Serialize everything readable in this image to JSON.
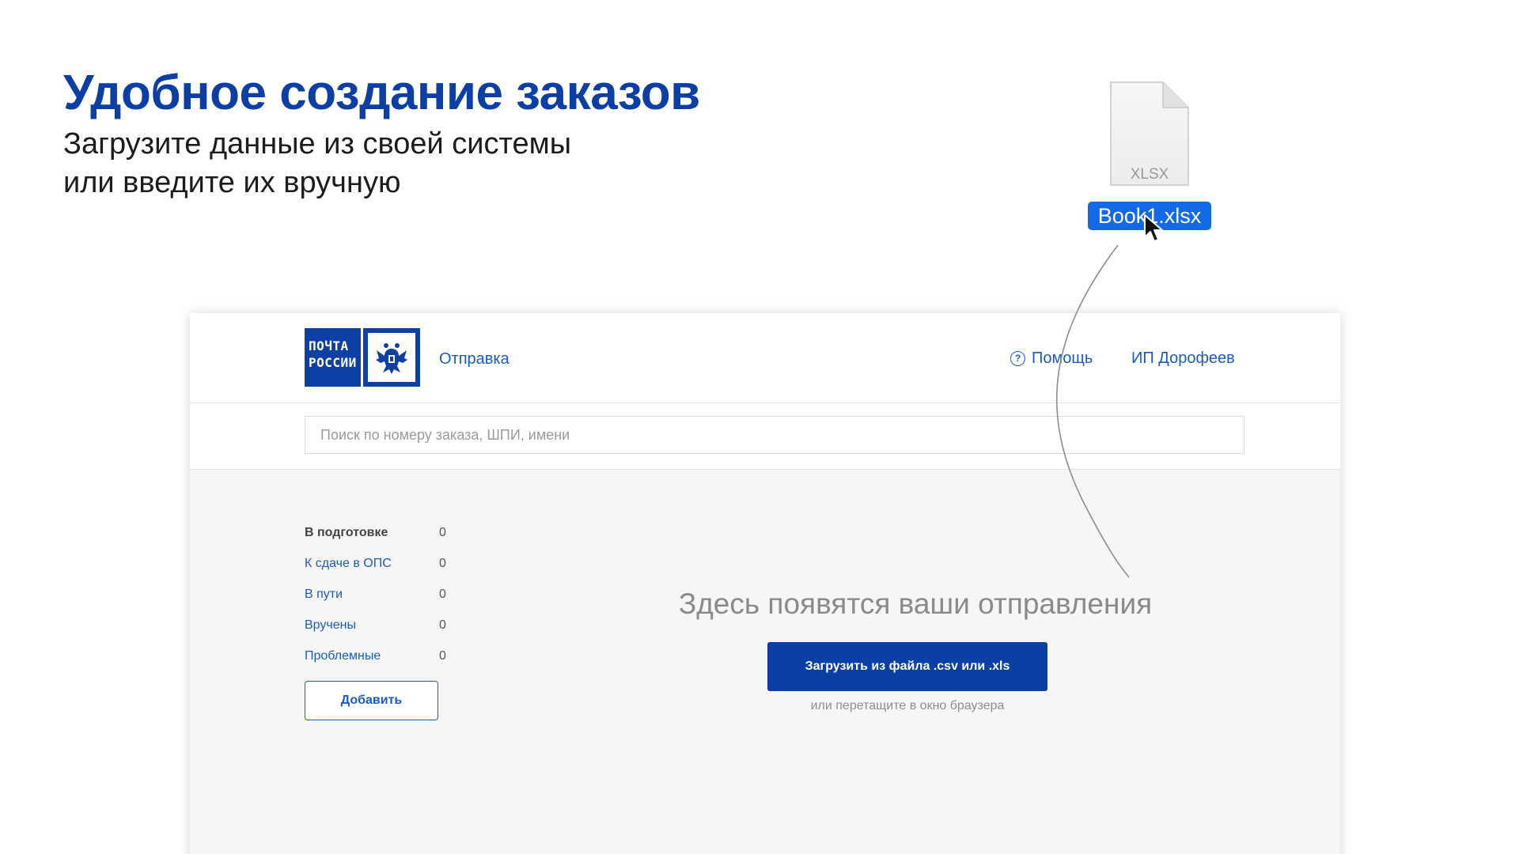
{
  "slide": {
    "title": "Удобное создание заказов",
    "subtitle_line1": "Загрузите данные из своей системы",
    "subtitle_line2": "или введите их вручную"
  },
  "desktop_file": {
    "type_label": "XLSX",
    "name": "Book1.xlsx",
    "icon": "spreadsheet-file-icon"
  },
  "app": {
    "logo": {
      "line1": "ПОЧТА",
      "line2": "РОССИИ",
      "icon": "double-headed-eagle-icon"
    },
    "nav": {
      "send": "Отправка",
      "help": "Помощь",
      "help_icon": "question-circle-icon",
      "user": "ИП Дорофеев"
    },
    "search": {
      "placeholder": "Поиск по номеру заказа, ШПИ, имени",
      "value": ""
    },
    "statuses": [
      {
        "label": "В подготовке",
        "count": "0"
      },
      {
        "label": "К сдаче в ОПС",
        "count": "0"
      },
      {
        "label": "В пути",
        "count": "0"
      },
      {
        "label": "Вручены",
        "count": "0"
      },
      {
        "label": "Проблемные",
        "count": "0"
      }
    ],
    "add_button": "Добавить",
    "empty_state": {
      "title": "Здесь появятся ваши отправления",
      "upload_button": "Загрузить из файла .csv или .xls",
      "hint": "или перетащите в окно браузера"
    }
  },
  "colors": {
    "brand_blue": "#0b3fa6",
    "link_blue": "#1a5cc0",
    "selection_blue": "#1469e6"
  }
}
